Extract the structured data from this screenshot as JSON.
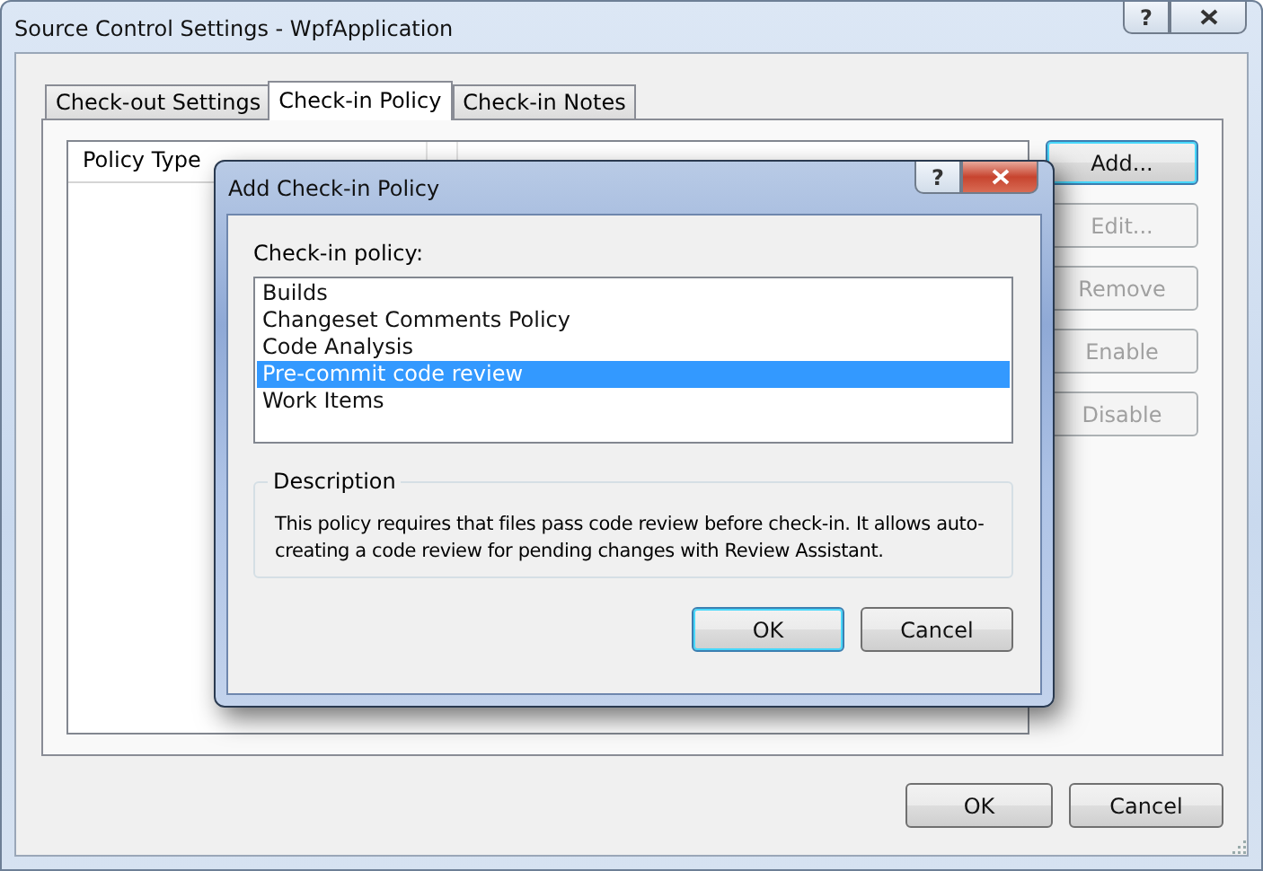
{
  "window": {
    "title": "Source Control Settings - WpfApplication",
    "help": "?"
  },
  "tabs": [
    {
      "label": "Check-out Settings",
      "selected": false
    },
    {
      "label": "Check-in Policy",
      "selected": true
    },
    {
      "label": "Check-in Notes",
      "selected": false
    }
  ],
  "policy_list": {
    "columns": [
      "Policy Type"
    ]
  },
  "side_buttons": [
    {
      "label": "Add...",
      "disabled": false,
      "focused": true
    },
    {
      "label": "Edit...",
      "disabled": true,
      "focused": false
    },
    {
      "label": "Remove",
      "disabled": true,
      "focused": false
    },
    {
      "label": "Enable",
      "disabled": true,
      "focused": false
    },
    {
      "label": "Disable",
      "disabled": true,
      "focused": false
    }
  ],
  "footer_buttons": [
    {
      "label": "OK",
      "focused": false
    },
    {
      "label": "Cancel",
      "focused": false
    }
  ],
  "dialog": {
    "title": "Add Check-in Policy",
    "help": "?",
    "list_label": "Check-in policy:",
    "items": [
      {
        "label": "Builds",
        "selected": false
      },
      {
        "label": "Changeset Comments Policy",
        "selected": false
      },
      {
        "label": "Code Analysis",
        "selected": false
      },
      {
        "label": "Pre-commit code review",
        "selected": true
      },
      {
        "label": "Work Items",
        "selected": false
      }
    ],
    "description_title": "Description",
    "description": "This policy requires that files pass code review before check-in. It allows auto-creating a code review for pending changes with Review Assistant.",
    "buttons": [
      {
        "label": "OK",
        "focused": true
      },
      {
        "label": "Cancel",
        "focused": false
      }
    ]
  }
}
